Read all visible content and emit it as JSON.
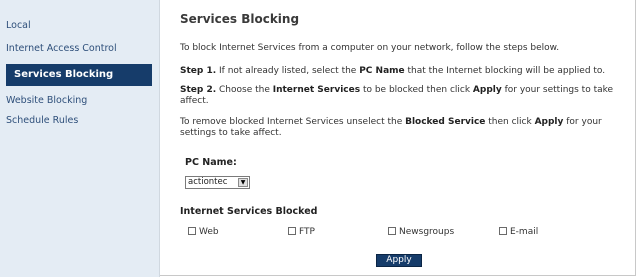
{
  "sidebar": {
    "items": [
      {
        "label": "Local"
      },
      {
        "label": "Internet Access Control"
      },
      {
        "label": "Services Blocking",
        "active": true
      },
      {
        "label": "Website Blocking"
      },
      {
        "label": "Schedule Rules"
      }
    ]
  },
  "main": {
    "title": "Services Blocking",
    "intro": "To block Internet Services from a computer on your network, follow the steps below.",
    "step1": {
      "prefix": "Step 1.",
      "text_a": " If not already listed, select the ",
      "bold_a": "PC Name",
      "text_b": " that the Internet blocking will be applied to."
    },
    "step2": {
      "prefix": "Step 2.",
      "text_a": " Choose the ",
      "bold_a": "Internet Services",
      "text_b": " to be blocked then click ",
      "bold_b": "Apply",
      "text_c": " for your settings to take affect."
    },
    "remove": {
      "text_a": "To remove blocked Internet Services unselect the ",
      "bold_a": "Blocked Service",
      "text_b": " then click ",
      "bold_b": "Apply",
      "text_c": " for your settings to take affect."
    },
    "pc_name_label": "PC Name:",
    "pc_name_value": "actiontec",
    "services_label": "Internet Services Blocked",
    "services": [
      {
        "label": "Web",
        "checked": false
      },
      {
        "label": "FTP",
        "checked": false
      },
      {
        "label": "Newsgroups",
        "checked": false
      },
      {
        "label": "E-mail",
        "checked": false
      }
    ],
    "apply_label": "Apply"
  },
  "colors": {
    "sidebar_bg": "#e4ecf4",
    "active_bg": "#163c6a",
    "link_text": "#2e4f7a"
  },
  "icons": {
    "dropdown": "chevron-down-icon"
  }
}
